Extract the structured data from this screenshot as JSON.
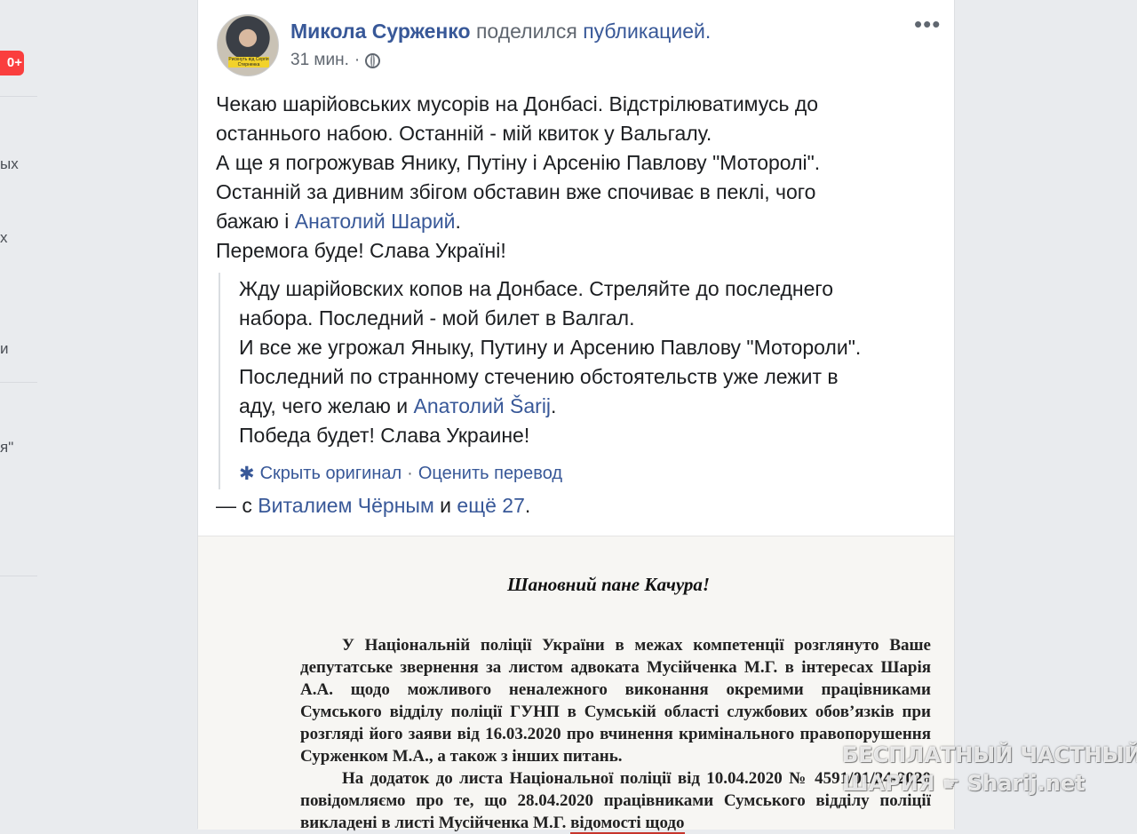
{
  "sidebar": {
    "badge": "0+",
    "fragments": [
      "ых",
      "х",
      "и",
      "я\""
    ]
  },
  "post": {
    "author": "Микола Сурженко",
    "action": "поделился",
    "action_link": "публикацией.",
    "time": "31 мин.",
    "time_sep": "·",
    "privacy_icon": "globe-icon",
    "more_icon": "more-options-icon",
    "avatar_banner": "Рискнуть від Сергія Стерненка",
    "text": [
      "Чекаю шарійовських мусорів на Донбасі. Відстрілюватимусь до",
      "останнього набою. Останній - мій квиток у Вальгалу.",
      "А ще я погрожував Янику, Путіну і Арсенію Павлову \"Моторолі\".",
      "Останній за дивним збігом обставин вже спочиває в пеклі, чого",
      "бажаю і ",
      "Анатолий Шарий",
      ".",
      "Перемога буде! Слава Україні!"
    ],
    "translation": [
      "Жду шарійовских копов на Донбасе. Стреляйте до последнего",
      "набора. Последний - мой билет в Валгал.",
      "И все же угрожал Яныку, Путину и Арсению Павлову \"Мотороли\".",
      "Последний по странному стечению обстоятельств уже лежит в",
      "аду, чего желаю и ",
      "Anатолий Šarij",
      ".",
      "Победа будет! Слава Украине!"
    ],
    "hide_original": "Скрыть оригинал",
    "rate_translation": "Оценить перевод",
    "with_prefix": "— с ",
    "with_person": "Виталием Чёрным",
    "with_and": " и ",
    "with_more": "ещё 27",
    "with_end": "."
  },
  "document": {
    "title": "Шановний пане Качура!",
    "p1": "У Національній поліції України в межах компетенції розглянуто Ваше депутатське звернення за листом адвоката Мусійченка М.Г. в інтересах Шарія А.А. щодо можливого неналежного виконання окремими працівниками Сумського відділу поліції ГУНП в Сумській області службових обов’язків при розгляді його заяви від 16.03.2020 про вчинення кримінального правопорушення Сурженком М.А., а також з інших питань.",
    "p2_start": "На додаток до листа Національної поліції від 10.04.2020 № 4591/01/24-2020 повідомляємо про те, що 28.04.2020 працівниками Сумського відділу поліції викладені в листі Мусійченка М.Г. ",
    "p2_underlined": "відомості щодо"
  },
  "watermark": {
    "line1": "БЕСПЛАТНЫЙ ЧАСТНЫЙ",
    "line2_a": "ШАРИЯ",
    "line2_b": "Sharij.net"
  }
}
